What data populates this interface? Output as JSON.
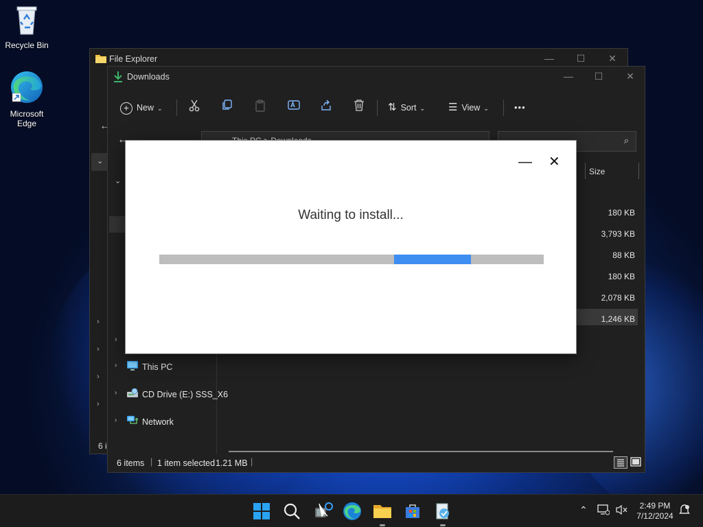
{
  "desktop": {
    "icons": [
      {
        "label": "Recycle Bin"
      },
      {
        "label": "Microsoft Edge"
      }
    ]
  },
  "explorer_back": {
    "title": "File Explorer",
    "status_count": "6 i"
  },
  "explorer": {
    "title": "Downloads",
    "toolbar": {
      "new_label": "New",
      "sort_label": "Sort",
      "view_label": "View",
      "more_label": "•••"
    },
    "address_partial": "This PC  >  Downloads",
    "column_size": "Size",
    "sizes": [
      "180 KB",
      "3,793 KB",
      "88 KB",
      "180 KB",
      "2,078 KB",
      "1,246 KB"
    ],
    "nav": [
      {
        "label": "This PC"
      },
      {
        "label": "CD Drive (E:) SSS_X6"
      },
      {
        "label": "Network"
      }
    ],
    "status": {
      "items": "6 items",
      "selected": "1 item selected",
      "size": "1.21 MB"
    }
  },
  "dialog": {
    "message": "Waiting to install...",
    "progress": {
      "start": 0.61,
      "end": 0.81
    },
    "colors": {
      "track": "#bdbdbd",
      "fill": "#3d8ef0"
    }
  },
  "taskbar": {
    "time": "2:49 PM",
    "date": "7/12/2024"
  }
}
